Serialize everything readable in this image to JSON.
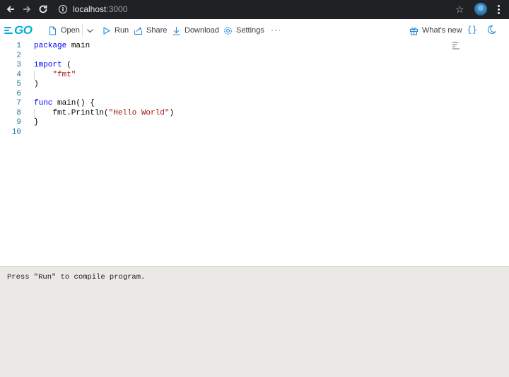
{
  "browser": {
    "url_host": "localhost",
    "url_port": ":3000"
  },
  "toolbar": {
    "logo_text": "GO",
    "open_label": "Open",
    "run_label": "Run",
    "share_label": "Share",
    "download_label": "Download",
    "settings_label": "Settings",
    "more_label": "···",
    "whats_new_label": "What's new",
    "format_label": "{}"
  },
  "editor": {
    "line_numbers": [
      "1",
      "2",
      "3",
      "4",
      "5",
      "6",
      "7",
      "8",
      "9",
      "10"
    ],
    "lines": {
      "l1_kw": "package",
      "l1_rest": " main",
      "l3_kw": "import",
      "l3_rest": " (",
      "l4_str": "\"fmt\"",
      "l5": ")",
      "l7_kw": "func",
      "l7_rest": " main() {",
      "l8_pre": "fmt.Println(",
      "l8_str": "\"Hello World\"",
      "l8_post": ")",
      "l9": "}"
    }
  },
  "output": {
    "message": "Press \"Run\" to compile program."
  },
  "colors": {
    "accent": "#00add8",
    "keyword": "#0000ff",
    "string": "#a31515",
    "line_number": "#237893",
    "output_bg": "#ebe9e6"
  }
}
